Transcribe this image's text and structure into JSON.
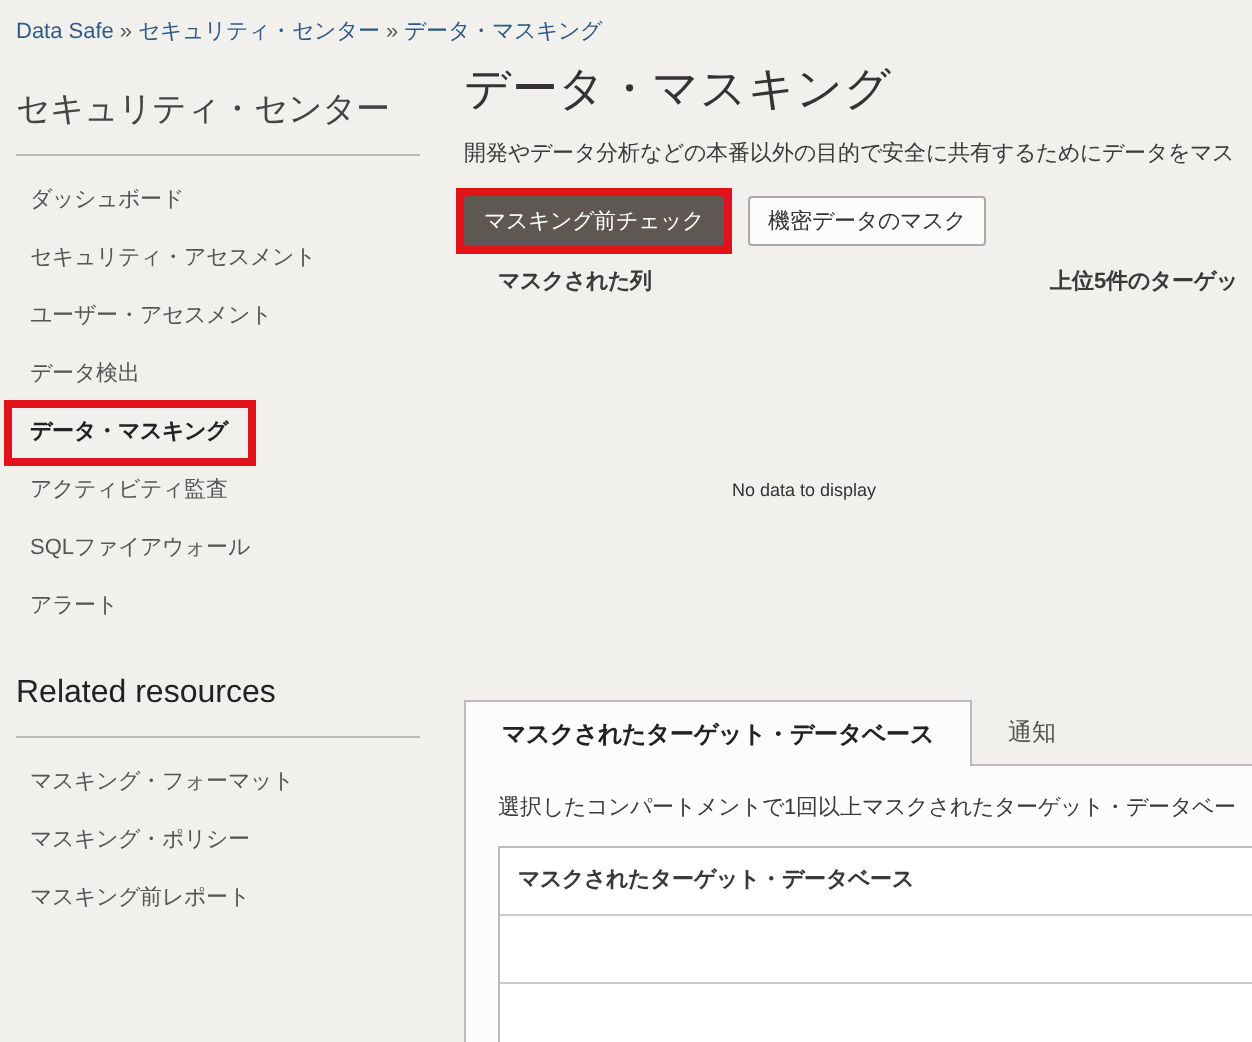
{
  "breadcrumb": {
    "separator": "»",
    "items": [
      "Data Safe",
      "セキュリティ・センター",
      "データ・マスキング"
    ]
  },
  "sidebar": {
    "title": "セキュリティ・センター",
    "items": [
      {
        "label": "ダッシュボード",
        "selected": false,
        "highlighted": false
      },
      {
        "label": "セキュリティ・アセスメント",
        "selected": false,
        "highlighted": false
      },
      {
        "label": "ユーザー・アセスメント",
        "selected": false,
        "highlighted": false
      },
      {
        "label": "データ検出",
        "selected": false,
        "highlighted": false
      },
      {
        "label": "データ・マスキング",
        "selected": true,
        "highlighted": true
      },
      {
        "label": "アクティビティ監査",
        "selected": false,
        "highlighted": false
      },
      {
        "label": "SQLファイアウォール",
        "selected": false,
        "highlighted": false
      },
      {
        "label": "アラート",
        "selected": false,
        "highlighted": false
      }
    ]
  },
  "related": {
    "title": "Related resources",
    "items": [
      "マスキング・フォーマット",
      "マスキング・ポリシー",
      "マスキング前レポート"
    ]
  },
  "main": {
    "title": "データ・マスキング",
    "description": "開発やデータ分析などの本番以外の目的で安全に共有するためにデータをマス",
    "buttons": [
      {
        "label": "マスキング前チェック",
        "kind": "primary",
        "highlighted": true
      },
      {
        "label": "機密データのマスク",
        "kind": "secondary",
        "highlighted": false
      }
    ],
    "summary_columns": [
      "マスクされた列",
      "上位5件のターゲッ"
    ],
    "empty_message": "No data to display",
    "tabs": [
      {
        "label": "マスクされたターゲット・データベース",
        "selected": true
      },
      {
        "label": "通知",
        "selected": false
      }
    ],
    "tab_description": "選択したコンパートメントで1回以上マスクされたターゲット・データベー",
    "table": {
      "columns": [
        "マスクされたターゲット・データベース"
      ]
    }
  }
}
